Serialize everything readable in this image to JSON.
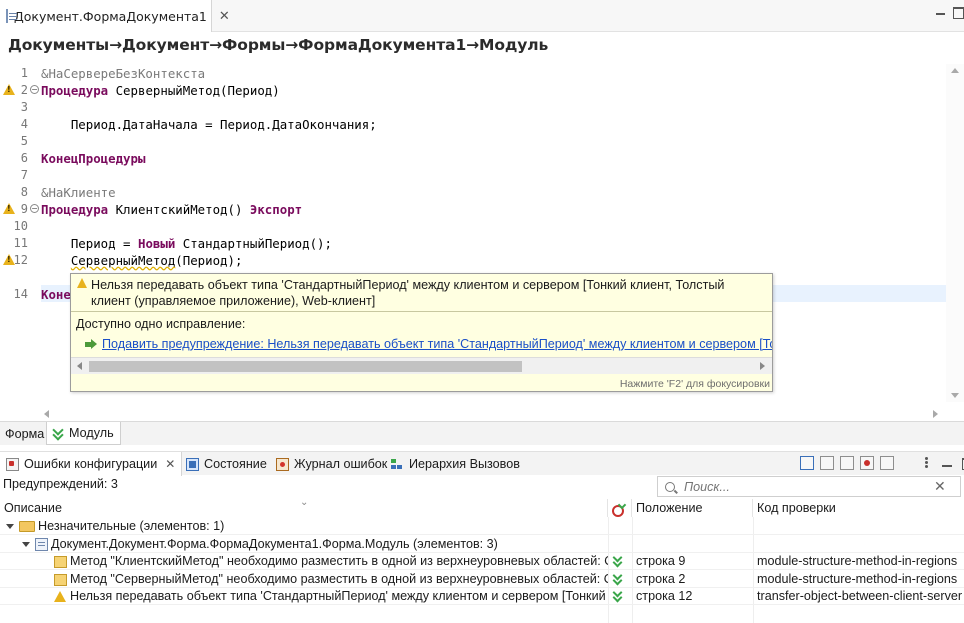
{
  "editor_tab": {
    "title": "Документ.ФормаДокумента1",
    "close": "✕"
  },
  "breadcrumb": "Документы→Документ→Формы→ФормаДокумента1→Модуль",
  "code_lines": [
    {
      "n": "1",
      "text": "&НаСервереБезКонтекста"
    },
    {
      "n": "2",
      "kw": "Процедура",
      "rest": " СерверныйМетод(Период)"
    },
    {
      "n": "3",
      "text": ""
    },
    {
      "n": "4",
      "text": "    Период.ДатаНачала = Период.ДатаОкончания;"
    },
    {
      "n": "5",
      "text": ""
    },
    {
      "n": "6",
      "kw": "КонецПроцедуры"
    },
    {
      "n": "7",
      "text": ""
    },
    {
      "n": "8",
      "text": "&НаКлиенте"
    },
    {
      "n": "9",
      "kw": "Процедура",
      "rest": " КлиентскийМетод() ",
      "kw2": "Экспорт"
    },
    {
      "n": "10",
      "text": ""
    },
    {
      "n": "11",
      "pre": "    Период = ",
      "kw": "Новый",
      "rest": " СтандартныйПериод();"
    },
    {
      "n": "12",
      "pre": "    ",
      "warn_text": "СерверныйМетод",
      "rest": "(Период);"
    },
    {
      "n": "14",
      "kw": "Коне"
    }
  ],
  "popup": {
    "message": "Нельзя передавать объект типа 'СтандартныйПериод' между клиентом и сервером [Тонкий клиент, Толстый клиент (управляемое приложение), Web-клиент]",
    "fix_count": "Доступно одно исправление:",
    "fix_link": "Подавить предупреждение: Нельзя передавать объект типа 'СтандартныйПериод' между клиентом и сервером [Тонкий",
    "status": "Нажмите 'F2' для фокусировки"
  },
  "bottom_tabs": {
    "form": "Форма",
    "module": "Модуль"
  },
  "panel_tabs": {
    "errors": "Ошибки конфигурации",
    "state": "Состояние",
    "journal": "Журнал ошибок",
    "hierarchy": "Иерархия Вызовов"
  },
  "warnings_count": "Предупреждений: 3",
  "search": {
    "placeholder": "Поиск..."
  },
  "table": {
    "headers": {
      "description": "Описание",
      "position": "Положение",
      "code": "Код проверки"
    },
    "group": "Незначительные (элементов: 1)",
    "module": "Документ.Документ.Форма.ФормаДокумента1.Форма.Модуль (элементов: 3)",
    "rows": [
      {
        "desc": "Метод \"КлиентскийМетод\" необходимо разместить в одной из верхнеуровневых областей: Опи",
        "pos": "строка 9",
        "code": "module-structure-method-in-regions"
      },
      {
        "desc": "Метод \"СерверныйМетод\" необходимо разместить в одной из верхнеуровневых областей: Опи",
        "pos": "строка 2",
        "code": "module-structure-method-in-regions"
      },
      {
        "desc": "Нельзя передавать объект типа 'СтандартныйПериод' между клиентом и сервером [Тонкий кли",
        "pos": "строка 12",
        "code": "transfer-object-between-client-server"
      }
    ]
  },
  "colors": {
    "keyword": "#7a0b5d",
    "link": "#1a4fc7",
    "warning": "#e8b21c",
    "popup_bg": "#ffffe1"
  }
}
